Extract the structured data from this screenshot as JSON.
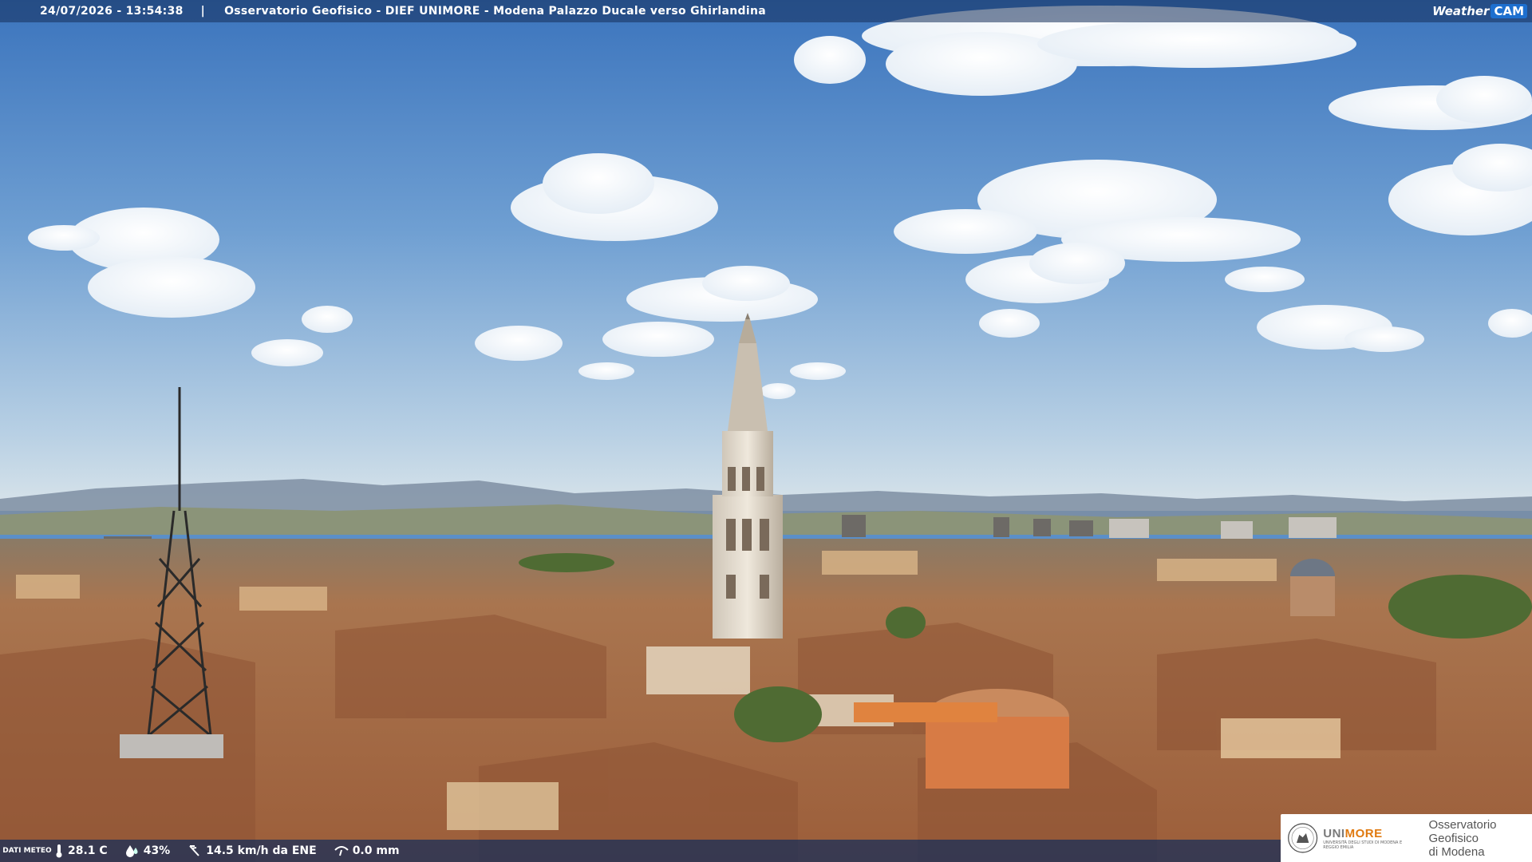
{
  "header": {
    "timestamp": "24/07/2026 - 13:54:38",
    "separator": "|",
    "title": "Osservatorio Geofisico - DIEF UNIMORE - Modena Palazzo Ducale verso Ghirlandina"
  },
  "brand": {
    "weather": "Weather",
    "cam": "CAM"
  },
  "weather": {
    "label": "DATI METEO",
    "temperature": "28.1 C",
    "humidity": "43%",
    "wind": "14.5 km/h da ENE",
    "rain": "0.0 mm",
    "icons": [
      "thermometer-icon",
      "humidity-icon",
      "wind-icon",
      "rain-gauge-icon"
    ]
  },
  "logo": {
    "unimore_a": "UNI",
    "unimore_b": "MORE",
    "university": "UNIVERSITÀ DEGLI STUDI DI MODENA E REGGIO EMILIA",
    "observatory_line1": "Osservatorio Geofisico",
    "observatory_line2": "di Modena"
  },
  "colors": {
    "sky_top": "#3f78bf",
    "sky_horizon": "#cfe0ea",
    "roofs": "#b7714a",
    "bar": "#142d5a",
    "accent": "#e07a10"
  }
}
